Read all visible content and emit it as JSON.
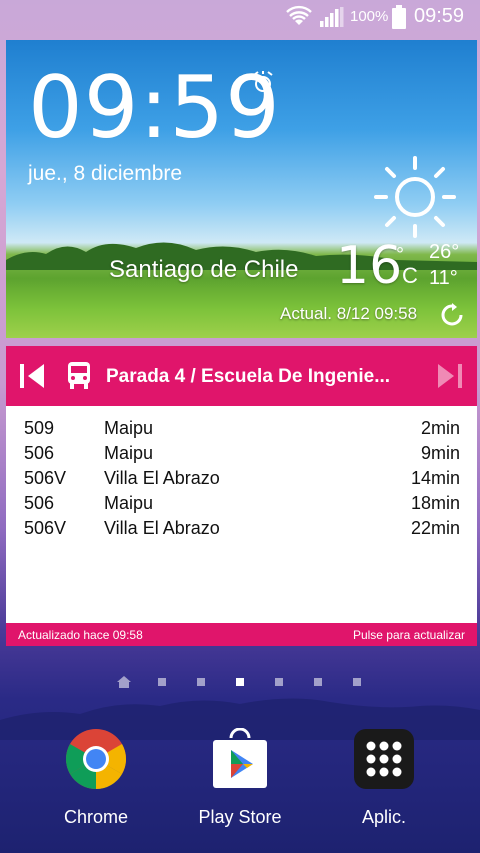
{
  "status_bar": {
    "battery_percent": "100%",
    "time": "09:59",
    "icons": [
      "wifi-icon",
      "signal-icon",
      "battery-icon"
    ]
  },
  "weather_widget": {
    "time": "09:59",
    "date": "jue., 8 diciembre",
    "city": "Santiago de Chile",
    "temperature": "16",
    "unit_degree": "°",
    "unit": "C",
    "high": "26°",
    "low": "11°",
    "updated": "Actual. 8/12 09:58",
    "icons": [
      "alarm-icon",
      "sunny-icon",
      "refresh-icon"
    ]
  },
  "bus_widget": {
    "stop_name": "Parada 4 / Escuela  De Ingenie...",
    "arrivals": [
      {
        "route": "509",
        "destination": "Maipu",
        "eta": "2min"
      },
      {
        "route": "506",
        "destination": "Maipu",
        "eta": "9min"
      },
      {
        "route": "506V",
        "destination": "Villa El Abrazo",
        "eta": "14min"
      },
      {
        "route": "506",
        "destination": "Maipu",
        "eta": "18min"
      },
      {
        "route": "506V",
        "destination": "Villa El Abrazo",
        "eta": "22min"
      }
    ],
    "footer_left": "Actualizado hace 09:58",
    "footer_right": "Pulse para actualizar",
    "accent_color": "#e0156b"
  },
  "home_pages": {
    "count": 7,
    "active_index": 3
  },
  "dock": {
    "apps": [
      {
        "label": "Chrome",
        "icon": "chrome-icon"
      },
      {
        "label": "Play Store",
        "icon": "play-store-icon"
      },
      {
        "label": "Aplic.",
        "icon": "apps-grid-icon"
      }
    ]
  }
}
